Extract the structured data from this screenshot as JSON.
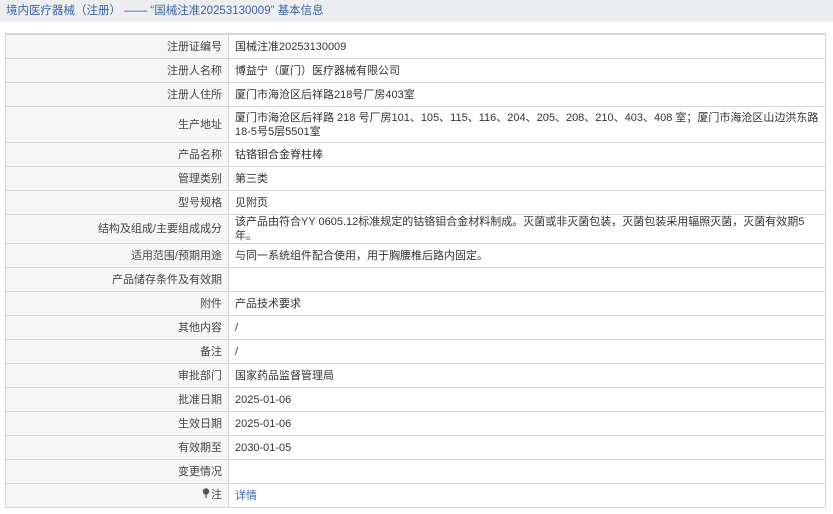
{
  "header": {
    "breadcrumb_main": "境内医疗器械（注册）",
    "separator": "——",
    "record_title": "“国械注准20253130009”",
    "suffix": "基本信息"
  },
  "rows": [
    {
      "label": "注册证编号",
      "value": "国械注准20253130009"
    },
    {
      "label": "注册人名称",
      "value": "博益宁（厦门）医疗器械有限公司"
    },
    {
      "label": "注册人住所",
      "value": "厦门市海沧区后祥路218号厂房403室"
    },
    {
      "label": "生产地址",
      "value": "厦门市海沧区后祥路 218 号厂房101、105、115、116、204、205、208、210、403、408 室；厦门市海沧区山边洪东路18-5号5层5501室"
    },
    {
      "label": "产品名称",
      "value": "钴铬钼合金脊柱棒"
    },
    {
      "label": "管理类别",
      "value": "第三类"
    },
    {
      "label": "型号规格",
      "value": "见附页"
    },
    {
      "label": "结构及组成/主要组成成分",
      "value": "该产品由符合YY 0605.12标准规定的钴铬钼合金材料制成。灭菌或非灭菌包装，灭菌包装采用辐照灭菌，灭菌有效期5年。"
    },
    {
      "label": "适用范围/预期用途",
      "value": "与同一系统组件配合使用，用于胸腰椎后路内固定。"
    },
    {
      "label": "产品储存条件及有效期",
      "value": ""
    },
    {
      "label": "附件",
      "value": "产品技术要求"
    },
    {
      "label": "其他内容",
      "value": "/"
    },
    {
      "label": "备注",
      "value": "/"
    },
    {
      "label": "审批部门",
      "value": "国家药品监督管理局"
    },
    {
      "label": "批准日期",
      "value": "2025-01-06"
    },
    {
      "label": "生效日期",
      "value": "2025-01-06"
    },
    {
      "label": "有效期至",
      "value": "2030-01-05"
    },
    {
      "label": "变更情况",
      "value": ""
    }
  ],
  "note_row": {
    "icon": "pin-icon",
    "label": "注",
    "link_text": "详情"
  },
  "colors": {
    "link": "#3a64a8",
    "header_bg": "#edeef0",
    "label_bg": "#f6f6f6",
    "border": "#d6d6d6"
  }
}
